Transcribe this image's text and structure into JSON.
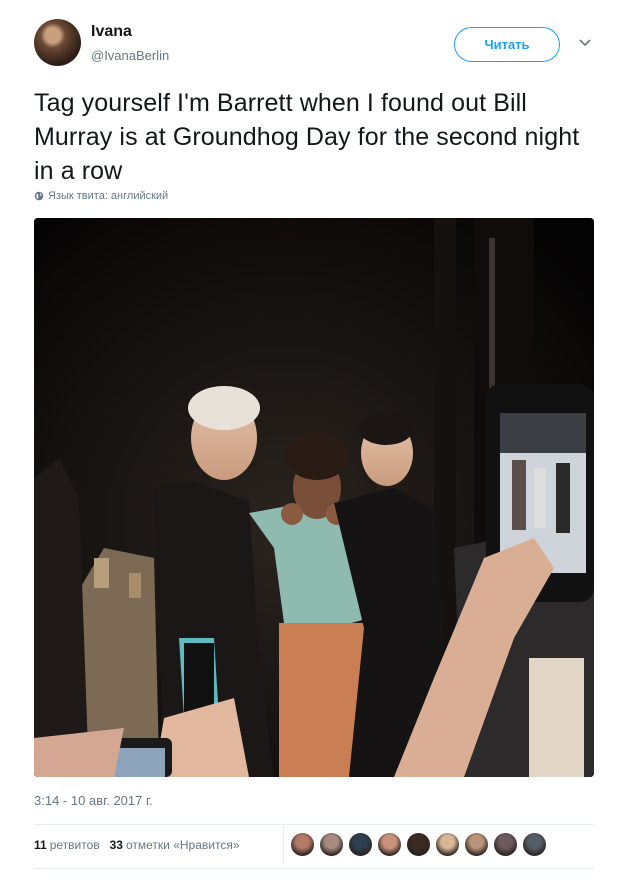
{
  "author": {
    "name": "Ivana",
    "handle": "@IvanaBerlin"
  },
  "follow_button_label": "Читать",
  "tweet": {
    "text": "Tag yourself I'm Barrett when I found out Bill Murray is at Groundhog Day for the second night in a row",
    "language_label": "Язык твита: английский",
    "timestamp": "3:14 - 10 авг. 2017 г."
  },
  "stats": {
    "retweets_count": "11",
    "retweets_label": "ретвитов",
    "likes_count": "33",
    "likes_label": "отметки «Нравится»"
  },
  "liker_avatar_colors": [
    "#b07a67",
    "#a78b7e",
    "#2f3f4f",
    "#c9927b",
    "#3b2a22",
    "#d8b796",
    "#b89479",
    "#6d5a5d",
    "#545d66"
  ],
  "colors": {
    "accent": "#1da1f2",
    "secondary_text": "#657786"
  }
}
